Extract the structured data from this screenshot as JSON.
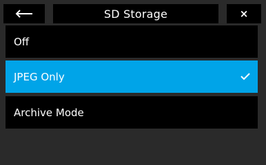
{
  "header": {
    "back_icon": "arrow-left-icon",
    "title": "SD Storage",
    "close_icon": "close-icon",
    "close_glyph": "×"
  },
  "options": [
    {
      "label": "Off",
      "selected": false
    },
    {
      "label": "JPEG Only",
      "selected": true
    },
    {
      "label": "Archive Mode",
      "selected": false
    }
  ],
  "colors": {
    "background": "#2a2a2a",
    "panel": "#000000",
    "selected": "#00a4e8",
    "text": "#ffffff"
  },
  "selected_icon": "checkmark-icon"
}
